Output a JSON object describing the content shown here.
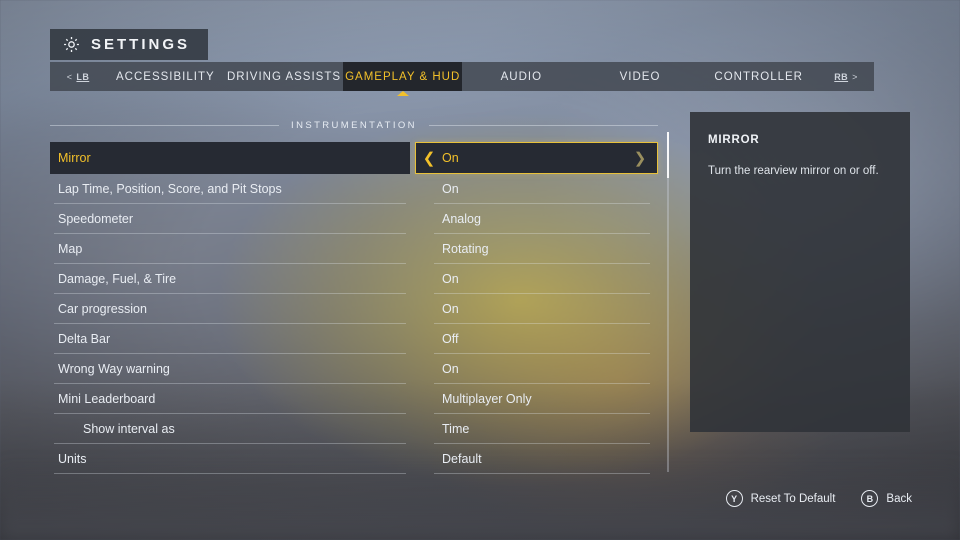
{
  "header": {
    "title": "SETTINGS",
    "gear_icon": "gear-icon"
  },
  "tabbar": {
    "left_bumper": {
      "prefix": "<",
      "key": "LB"
    },
    "right_bumper": {
      "key": "RB",
      "suffix": ">"
    },
    "tabs": [
      {
        "label": "ACCESSIBILITY",
        "active": false
      },
      {
        "label": "DRIVING ASSISTS",
        "active": false
      },
      {
        "label": "GAMEPLAY & HUD",
        "active": true
      },
      {
        "label": "AUDIO",
        "active": false
      },
      {
        "label": "VIDEO",
        "active": false
      },
      {
        "label": "CONTROLLER",
        "active": false
      }
    ]
  },
  "section": {
    "label": "INSTRUMENTATION"
  },
  "settings": [
    {
      "label": "Mirror",
      "value": "On",
      "selected": true,
      "indent": false
    },
    {
      "label": "Lap Time, Position, Score, and Pit Stops",
      "value": "On",
      "selected": false,
      "indent": false
    },
    {
      "label": "Speedometer",
      "value": "Analog",
      "selected": false,
      "indent": false
    },
    {
      "label": "Map",
      "value": "Rotating",
      "selected": false,
      "indent": false
    },
    {
      "label": "Damage, Fuel, & Tire",
      "value": "On",
      "selected": false,
      "indent": false
    },
    {
      "label": "Car progression",
      "value": "On",
      "selected": false,
      "indent": false
    },
    {
      "label": "Delta Bar",
      "value": "Off",
      "selected": false,
      "indent": false
    },
    {
      "label": "Wrong Way warning",
      "value": "On",
      "selected": false,
      "indent": false
    },
    {
      "label": "Mini Leaderboard",
      "value": "Multiplayer Only",
      "selected": false,
      "indent": false
    },
    {
      "label": "Show interval as",
      "value": "Time",
      "selected": false,
      "indent": true
    },
    {
      "label": "Units",
      "value": "Default",
      "selected": false,
      "indent": false
    }
  ],
  "selector": {
    "left_chevron": "❮",
    "right_chevron": "❯"
  },
  "description": {
    "title": "MIRROR",
    "body": "Turn the rearview mirror on or off."
  },
  "footer": {
    "actions": [
      {
        "glyph": "Y",
        "label": "Reset To Default"
      },
      {
        "glyph": "B",
        "label": "Back"
      }
    ]
  },
  "colors": {
    "accent_gold": "#f2c02a",
    "selected_row_bg": "#262a33",
    "panel_bg": "#30333 9",
    "text_primary": "#e9edf3"
  }
}
